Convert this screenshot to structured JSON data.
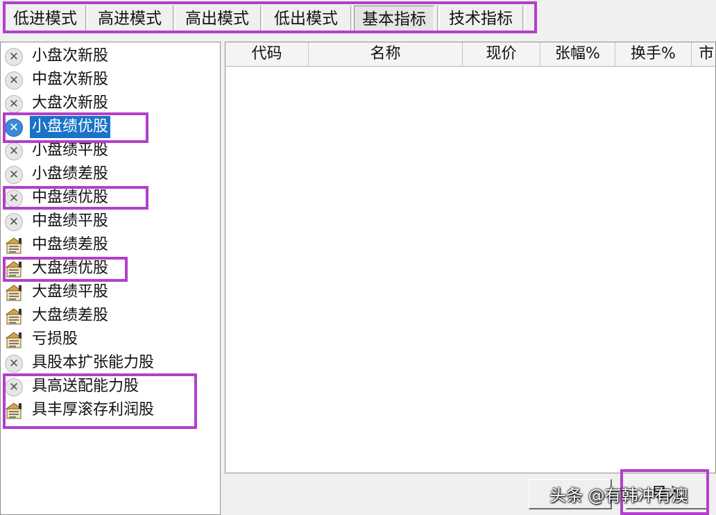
{
  "tabs": [
    {
      "label": "低进模式"
    },
    {
      "label": "高进模式"
    },
    {
      "label": "高出模式"
    },
    {
      "label": "低出模式"
    },
    {
      "label": "基本指标",
      "active": true
    },
    {
      "label": "技术指标"
    }
  ],
  "list": {
    "items": [
      {
        "label": "小盘次新股",
        "icon": "x-circle-icon"
      },
      {
        "label": "中盘次新股",
        "icon": "x-circle-icon"
      },
      {
        "label": "大盘次新股",
        "icon": "x-circle-icon"
      },
      {
        "label": "小盘绩优股",
        "icon": "x-circle-icon",
        "selected": true
      },
      {
        "label": "小盘绩平股",
        "icon": "x-circle-icon"
      },
      {
        "label": "小盘绩差股",
        "icon": "x-circle-icon"
      },
      {
        "label": "中盘绩优股",
        "icon": "x-circle-icon"
      },
      {
        "label": "中盘绩平股",
        "icon": "x-circle-icon"
      },
      {
        "label": "中盘绩差股",
        "icon": "formula-note-icon"
      },
      {
        "label": "大盘绩优股",
        "icon": "formula-note-icon"
      },
      {
        "label": "大盘绩平股",
        "icon": "formula-note-icon"
      },
      {
        "label": "大盘绩差股",
        "icon": "formula-note-icon"
      },
      {
        "label": "亏损股",
        "icon": "formula-note-icon"
      },
      {
        "label": "具股本扩张能力股",
        "icon": "x-circle-icon"
      },
      {
        "label": "具高送配能力股",
        "icon": "x-circle-icon"
      },
      {
        "label": "具丰厚滚存利润股",
        "icon": "formula-note-icon"
      }
    ]
  },
  "grid": {
    "columns": [
      "代码",
      "名称",
      "现价",
      "张幅%",
      "换手%",
      "市"
    ]
  },
  "buttons": {
    "left_label": "",
    "right_label": "导入"
  },
  "watermark": "头条 @有韩冲有澳",
  "colors": {
    "highlight": "#b23fcc",
    "selection": "#1a73c9"
  }
}
